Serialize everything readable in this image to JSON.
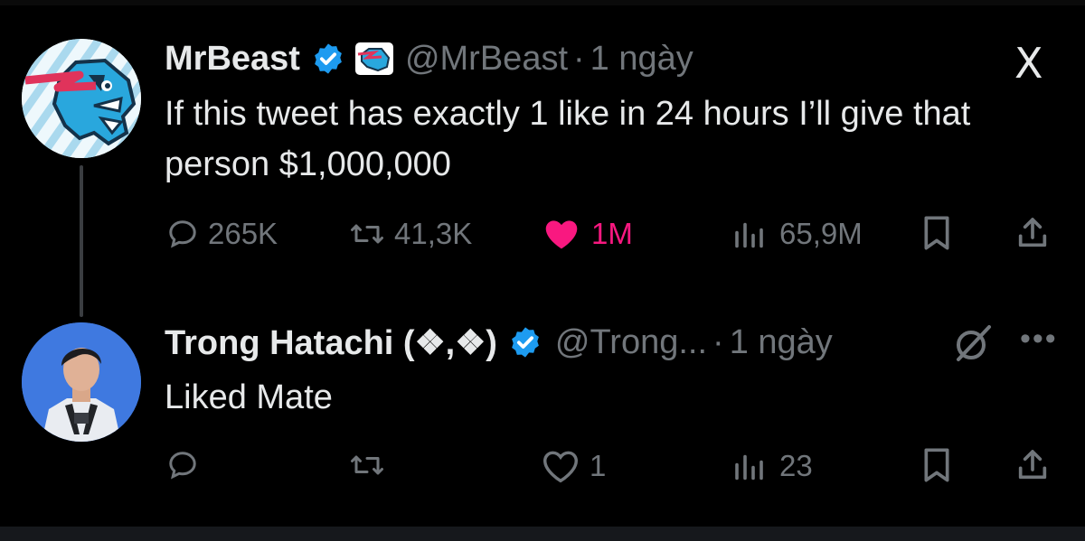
{
  "tweet": {
    "author_name": "MrBeast",
    "handle": "@MrBeast",
    "separator": "·",
    "time": "1 ngày",
    "text": "If this tweet has exactly 1 like in 24 hours I’ll give that person $1,000,000",
    "replies": "265K",
    "reposts": "41,3K",
    "likes": "1M",
    "views": "65,9M",
    "liked": true,
    "like_color": "#f91880"
  },
  "reply": {
    "author_name": "Trong Hatachi (❖,❖)",
    "handle": "@Trong...",
    "separator": "·",
    "time": "1 ngày",
    "text": "Liked Mate",
    "replies": "",
    "reposts": "",
    "likes": "1",
    "views": "23"
  },
  "icons": {
    "platform_logo": "X",
    "verified_color": "#1d9bf0",
    "more": "•••"
  }
}
